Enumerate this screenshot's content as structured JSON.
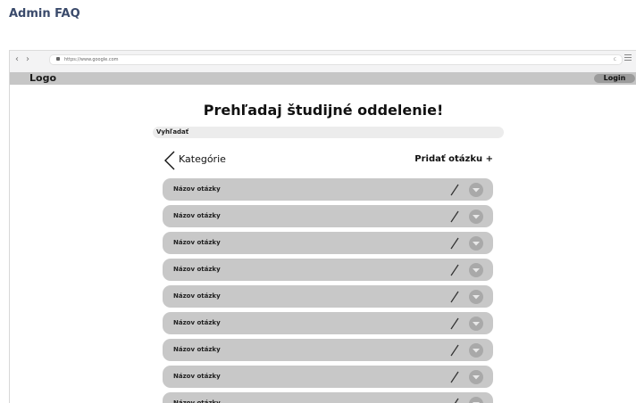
{
  "page_heading": "Admin FAQ",
  "browser": {
    "url": "https://www.google.com",
    "back_glyph": "‹",
    "forward_glyph": "›",
    "reload_glyph": "c"
  },
  "app": {
    "logo": "Logo",
    "login_label": "Login"
  },
  "main": {
    "title": "Prehľadaj študijné oddelenie!",
    "search_placeholder": "Vyhľadať",
    "back_label": "Kategórie",
    "add_question_label": "Pridať otázku +",
    "questions": [
      {
        "label": "Názov otázky"
      },
      {
        "label": "Názov otázky"
      },
      {
        "label": "Názov otázky"
      },
      {
        "label": "Názov otázky"
      },
      {
        "label": "Názov otázky"
      },
      {
        "label": "Názov otázky"
      },
      {
        "label": "Názov otázky"
      },
      {
        "label": "Názov otázky"
      },
      {
        "label": "Názov otázky"
      }
    ]
  },
  "icons": {
    "edit": "pencil-icon",
    "expand": "chevron-down-icon",
    "back": "chevron-left-icon"
  }
}
